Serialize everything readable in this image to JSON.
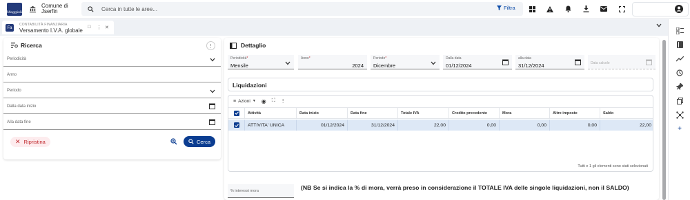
{
  "header": {
    "logo_text": "Maggioli",
    "org_line1": "Comune di",
    "org_line2": "Jserfin",
    "search_placeholder": "Cerca in tutte le aree...",
    "filter_label": "Filtra"
  },
  "tab": {
    "badge": "Fa",
    "category": "CONTABILITÀ FINANZIARIA",
    "title": "Versamento I.V.A. globale"
  },
  "search_panel": {
    "title": "Ricerca",
    "fields": [
      {
        "label": "Periodicità",
        "kind": "select"
      },
      {
        "label": "Anno",
        "kind": "text"
      },
      {
        "label": "Periodo",
        "kind": "select"
      },
      {
        "label": "Dalla data inizio",
        "kind": "date"
      },
      {
        "label": "Alla data fine",
        "kind": "date"
      }
    ],
    "reset_label": "Ripristina",
    "search_label": "Cerca"
  },
  "detail": {
    "title": "Dettaglio",
    "fields": {
      "periodicita": {
        "label": "Periodicità",
        "value": "Mensile"
      },
      "anno": {
        "label": "Anno",
        "value": "2024"
      },
      "periodo": {
        "label": "Periodo",
        "value": "Dicembre"
      },
      "dalla_data": {
        "label": "Dalla data",
        "value": "01/12/2024"
      },
      "alla_data": {
        "label": "alla data",
        "value": "31/12/2024"
      },
      "data_calcolo": {
        "label": "Data calcolo",
        "value": ""
      }
    },
    "liquidazioni_title": "Liquidazioni",
    "actions_label": "Azioni",
    "columns": [
      "Attività",
      "Data inizio",
      "Data fine",
      "Totale IVA",
      "Credito precedente",
      "Mora",
      "Altre imposte",
      "Saldo"
    ],
    "rows": [
      {
        "attivita": "ATTIVITA' UNICA",
        "data_inizio": "01/12/2024",
        "data_fine": "31/12/2024",
        "totale_iva": "22,00",
        "credito_precedente": "0,00",
        "mora": "0,00",
        "altre_imposte": "0,00",
        "saldo": "22,00"
      }
    ],
    "selection_status": "Tutti e 1 gli elementi sono stati selezionati",
    "mora_label": "% interessi mora",
    "note": "(NB Se si indica la % di mora, verrà preso in considerazione il TOTALE IVA delle singole liquidazioni, non il SALDO)"
  },
  "colors": {
    "primary": "#0b3d91",
    "danger": "#c0282d",
    "selected_row": "#dde8f6",
    "brand": "#233a7a"
  }
}
